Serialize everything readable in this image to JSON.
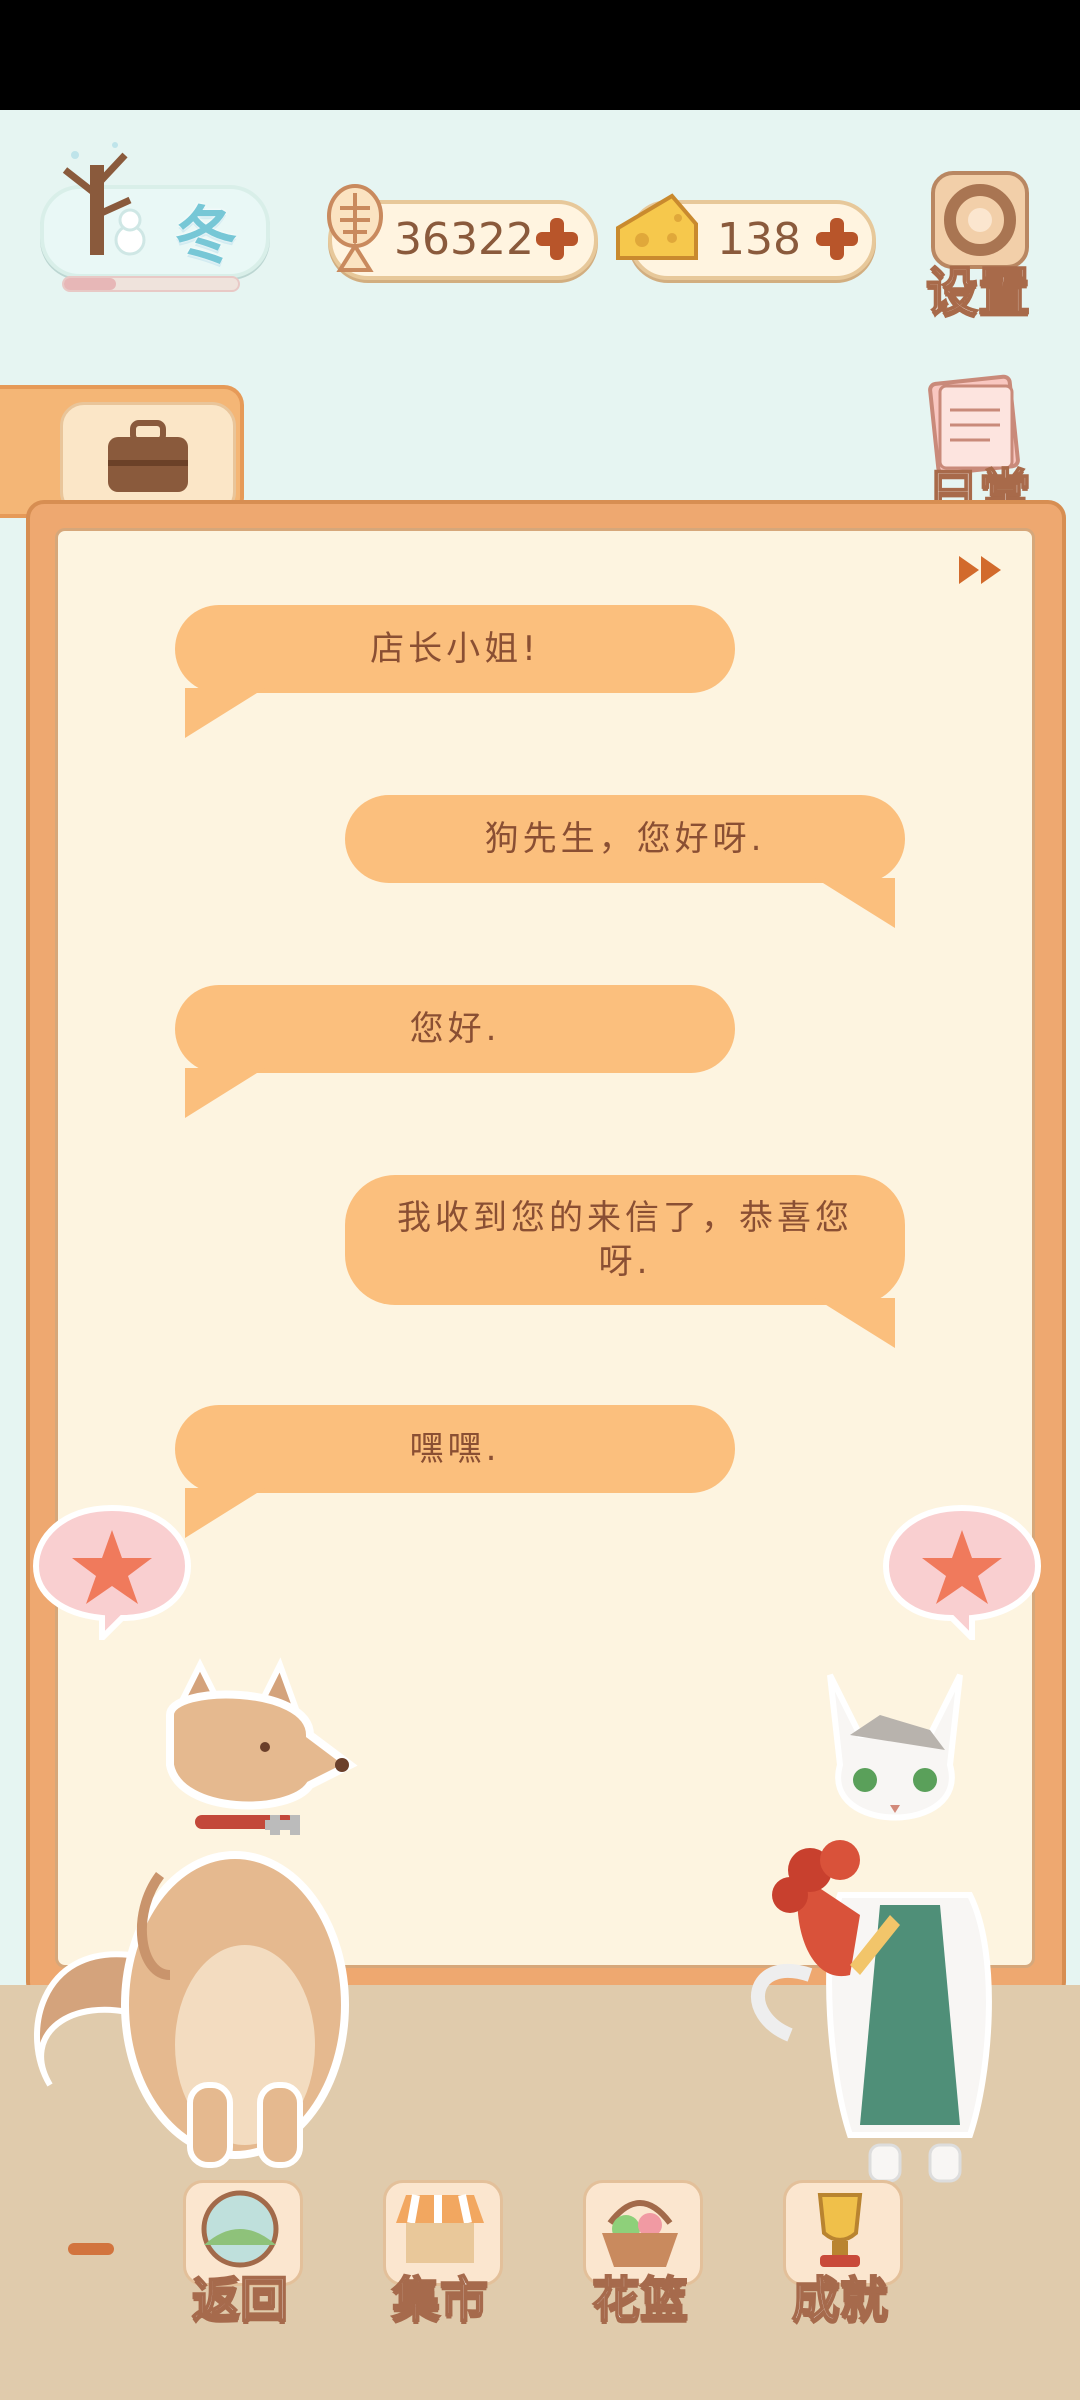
{
  "hud": {
    "season": {
      "label": "冬",
      "progress": 0.3
    },
    "currency_fish": {
      "value": "36322",
      "icon": "fish-bone-icon"
    },
    "currency_cheese": {
      "value": "138",
      "icon": "cheese-icon"
    },
    "settings_label": "设置",
    "daily_label": "日常"
  },
  "dialog": {
    "messages": [
      {
        "speaker": "left",
        "text": "店长小姐!"
      },
      {
        "speaker": "right",
        "text": "狗先生，您好呀."
      },
      {
        "speaker": "left",
        "text": "您好."
      },
      {
        "speaker": "right",
        "text": "我收到您的来信了，恭喜您呀."
      },
      {
        "speaker": "left",
        "text": "嘿嘿."
      }
    ]
  },
  "bottom_nav": [
    {
      "label": "返回",
      "icon": "window-icon"
    },
    {
      "label": "集市",
      "icon": "market-stall-icon"
    },
    {
      "label": "花篮",
      "icon": "flower-basket-icon"
    },
    {
      "label": "成就",
      "icon": "trophy-icon"
    }
  ],
  "colors": {
    "accent": "#fbbf7d",
    "text_brown": "#8a4f33",
    "frame": "#eea870",
    "sky": "#e6f5f2"
  }
}
